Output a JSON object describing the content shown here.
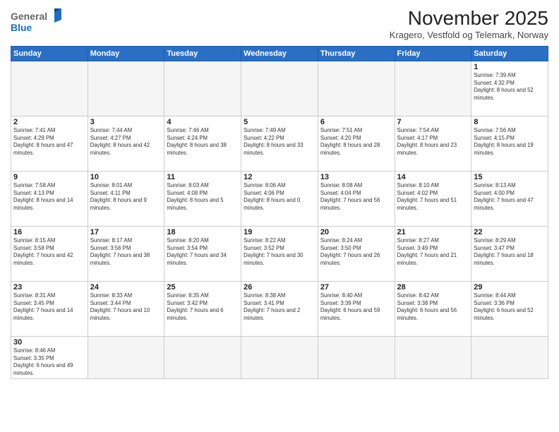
{
  "header": {
    "logo_general": "General",
    "logo_blue": "Blue",
    "month_title": "November 2025",
    "subtitle": "Kragero, Vestfold og Telemark, Norway"
  },
  "weekdays": [
    "Sunday",
    "Monday",
    "Tuesday",
    "Wednesday",
    "Thursday",
    "Friday",
    "Saturday"
  ],
  "days": {
    "1": {
      "sunrise": "Sunrise: 7:39 AM",
      "sunset": "Sunset: 4:32 PM",
      "daylight": "Daylight: 8 hours and 52 minutes."
    },
    "2": {
      "sunrise": "Sunrise: 7:41 AM",
      "sunset": "Sunset: 4:29 PM",
      "daylight": "Daylight: 8 hours and 47 minutes."
    },
    "3": {
      "sunrise": "Sunrise: 7:44 AM",
      "sunset": "Sunset: 4:27 PM",
      "daylight": "Daylight: 8 hours and 42 minutes."
    },
    "4": {
      "sunrise": "Sunrise: 7:46 AM",
      "sunset": "Sunset: 4:24 PM",
      "daylight": "Daylight: 8 hours and 38 minutes."
    },
    "5": {
      "sunrise": "Sunrise: 7:49 AM",
      "sunset": "Sunset: 4:22 PM",
      "daylight": "Daylight: 8 hours and 33 minutes."
    },
    "6": {
      "sunrise": "Sunrise: 7:51 AM",
      "sunset": "Sunset: 4:20 PM",
      "daylight": "Daylight: 8 hours and 28 minutes."
    },
    "7": {
      "sunrise": "Sunrise: 7:54 AM",
      "sunset": "Sunset: 4:17 PM",
      "daylight": "Daylight: 8 hours and 23 minutes."
    },
    "8": {
      "sunrise": "Sunrise: 7:56 AM",
      "sunset": "Sunset: 4:15 PM",
      "daylight": "Daylight: 8 hours and 19 minutes."
    },
    "9": {
      "sunrise": "Sunrise: 7:58 AM",
      "sunset": "Sunset: 4:13 PM",
      "daylight": "Daylight: 8 hours and 14 minutes."
    },
    "10": {
      "sunrise": "Sunrise: 8:01 AM",
      "sunset": "Sunset: 4:11 PM",
      "daylight": "Daylight: 8 hours and 9 minutes."
    },
    "11": {
      "sunrise": "Sunrise: 8:03 AM",
      "sunset": "Sunset: 4:08 PM",
      "daylight": "Daylight: 8 hours and 5 minutes."
    },
    "12": {
      "sunrise": "Sunrise: 8:06 AM",
      "sunset": "Sunset: 4:06 PM",
      "daylight": "Daylight: 8 hours and 0 minutes."
    },
    "13": {
      "sunrise": "Sunrise: 8:08 AM",
      "sunset": "Sunset: 4:04 PM",
      "daylight": "Daylight: 7 hours and 56 minutes."
    },
    "14": {
      "sunrise": "Sunrise: 8:10 AM",
      "sunset": "Sunset: 4:02 PM",
      "daylight": "Daylight: 7 hours and 51 minutes."
    },
    "15": {
      "sunrise": "Sunrise: 8:13 AM",
      "sunset": "Sunset: 4:00 PM",
      "daylight": "Daylight: 7 hours and 47 minutes."
    },
    "16": {
      "sunrise": "Sunrise: 8:15 AM",
      "sunset": "Sunset: 3:58 PM",
      "daylight": "Daylight: 7 hours and 42 minutes."
    },
    "17": {
      "sunrise": "Sunrise: 8:17 AM",
      "sunset": "Sunset: 3:56 PM",
      "daylight": "Daylight: 7 hours and 38 minutes."
    },
    "18": {
      "sunrise": "Sunrise: 8:20 AM",
      "sunset": "Sunset: 3:54 PM",
      "daylight": "Daylight: 7 hours and 34 minutes."
    },
    "19": {
      "sunrise": "Sunrise: 8:22 AM",
      "sunset": "Sunset: 3:52 PM",
      "daylight": "Daylight: 7 hours and 30 minutes."
    },
    "20": {
      "sunrise": "Sunrise: 8:24 AM",
      "sunset": "Sunset: 3:50 PM",
      "daylight": "Daylight: 7 hours and 26 minutes."
    },
    "21": {
      "sunrise": "Sunrise: 8:27 AM",
      "sunset": "Sunset: 3:49 PM",
      "daylight": "Daylight: 7 hours and 21 minutes."
    },
    "22": {
      "sunrise": "Sunrise: 8:29 AM",
      "sunset": "Sunset: 3:47 PM",
      "daylight": "Daylight: 7 hours and 18 minutes."
    },
    "23": {
      "sunrise": "Sunrise: 8:31 AM",
      "sunset": "Sunset: 3:45 PM",
      "daylight": "Daylight: 7 hours and 14 minutes."
    },
    "24": {
      "sunrise": "Sunrise: 8:33 AM",
      "sunset": "Sunset: 3:44 PM",
      "daylight": "Daylight: 7 hours and 10 minutes."
    },
    "25": {
      "sunrise": "Sunrise: 8:35 AM",
      "sunset": "Sunset: 3:42 PM",
      "daylight": "Daylight: 7 hours and 6 minutes."
    },
    "26": {
      "sunrise": "Sunrise: 8:38 AM",
      "sunset": "Sunset: 3:41 PM",
      "daylight": "Daylight: 7 hours and 2 minutes."
    },
    "27": {
      "sunrise": "Sunrise: 8:40 AM",
      "sunset": "Sunset: 3:39 PM",
      "daylight": "Daylight: 6 hours and 59 minutes."
    },
    "28": {
      "sunrise": "Sunrise: 8:42 AM",
      "sunset": "Sunset: 3:38 PM",
      "daylight": "Daylight: 6 hours and 56 minutes."
    },
    "29": {
      "sunrise": "Sunrise: 8:44 AM",
      "sunset": "Sunset: 3:36 PM",
      "daylight": "Daylight: 6 hours and 52 minutes."
    },
    "30": {
      "sunrise": "Sunrise: 8:46 AM",
      "sunset": "Sunset: 3:35 PM",
      "daylight": "Daylight: 6 hours and 49 minutes."
    }
  }
}
